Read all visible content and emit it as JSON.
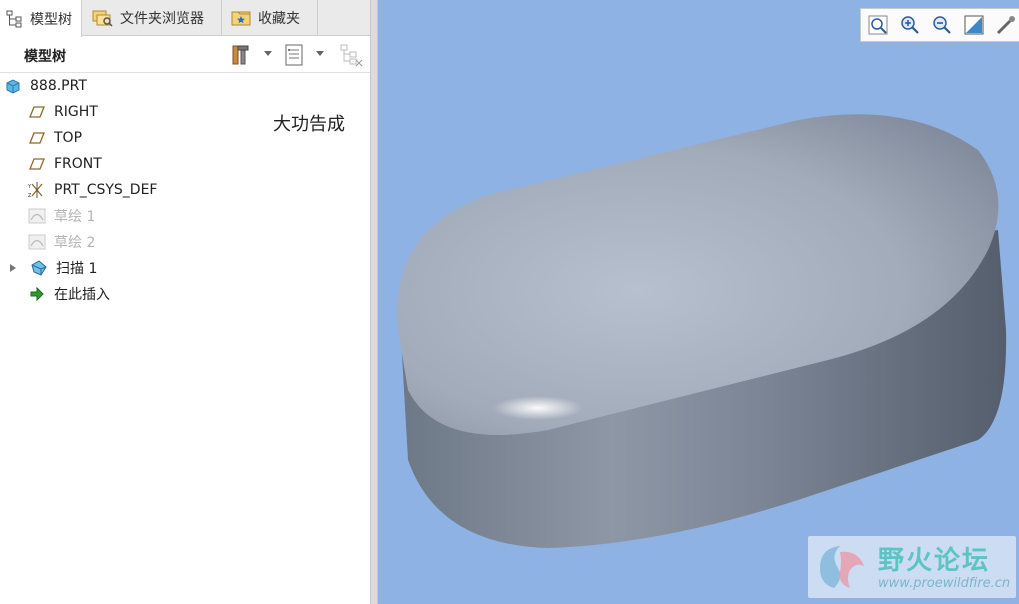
{
  "tabs": [
    {
      "label": "模型树",
      "icon": "model-tree-icon"
    },
    {
      "label": "文件夹浏览器",
      "icon": "folder-browser-icon"
    },
    {
      "label": "收藏夹",
      "icon": "favorites-icon"
    }
  ],
  "toolbar": {
    "title": "模型树"
  },
  "tree": {
    "root": "888.PRT",
    "items": [
      {
        "label": "RIGHT",
        "icon": "datum-plane-icon",
        "dim": false
      },
      {
        "label": "TOP",
        "icon": "datum-plane-icon",
        "dim": false
      },
      {
        "label": "FRONT",
        "icon": "datum-plane-icon",
        "dim": false
      },
      {
        "label": "PRT_CSYS_DEF",
        "icon": "coordinate-system-icon",
        "dim": false
      },
      {
        "label": "草绘 1",
        "icon": "sketch-icon",
        "dim": true
      },
      {
        "label": "草绘 2",
        "icon": "sketch-icon",
        "dim": true
      },
      {
        "label": "扫描 1",
        "icon": "sweep-icon",
        "dim": false,
        "expandable": true
      },
      {
        "label": "在此插入",
        "icon": "insert-here-icon",
        "dim": false
      }
    ]
  },
  "note": "大功告成",
  "watermark": {
    "name": "野火论坛",
    "url": "www.proewildfire.cn"
  },
  "colors": {
    "viewport_bg": "#8fb2e4",
    "model_gray": "#9aa3b3"
  }
}
